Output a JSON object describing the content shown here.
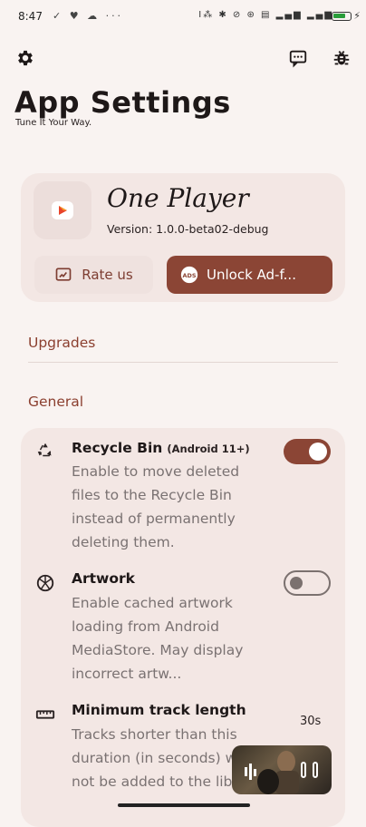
{
  "status_bar": {
    "time": "8:47",
    "left_icons": "✓ ♥ ☁ ···",
    "right_icons": "Ⅰ⁂ ✱ ⊘ ⊛ ▤ ▂▄▆ ▂▄▆"
  },
  "header": {
    "title": "App Settings",
    "subtitle": "Tune It Your Way."
  },
  "app_card": {
    "name": "One Player",
    "version": "Version: 1.0.0-beta02-debug",
    "rate_label": "Rate us",
    "unlock_label": "Unlock Ad-f..."
  },
  "sections": {
    "upgrades": "Upgrades",
    "general": "General"
  },
  "settings": {
    "recycle_bin": {
      "title": "Recycle Bin",
      "tag": "(Android 11+)",
      "description": "Enable to move deleted files to the Recycle Bin instead of permanently deleting them.",
      "enabled": true
    },
    "artwork": {
      "title": "Artwork",
      "description": "Enable cached artwork loading from Android MediaStore. May display incorrect artw...",
      "enabled": false
    },
    "min_track_length": {
      "title": "Minimum track length",
      "description": "Tracks shorter than this duration (in seconds) will not be added to the library",
      "value": "30s"
    }
  },
  "colors": {
    "accent": "#8b4535",
    "section_header": "#8b3f2f",
    "background": "#f9f3f1",
    "card": "#f3e7e4"
  }
}
